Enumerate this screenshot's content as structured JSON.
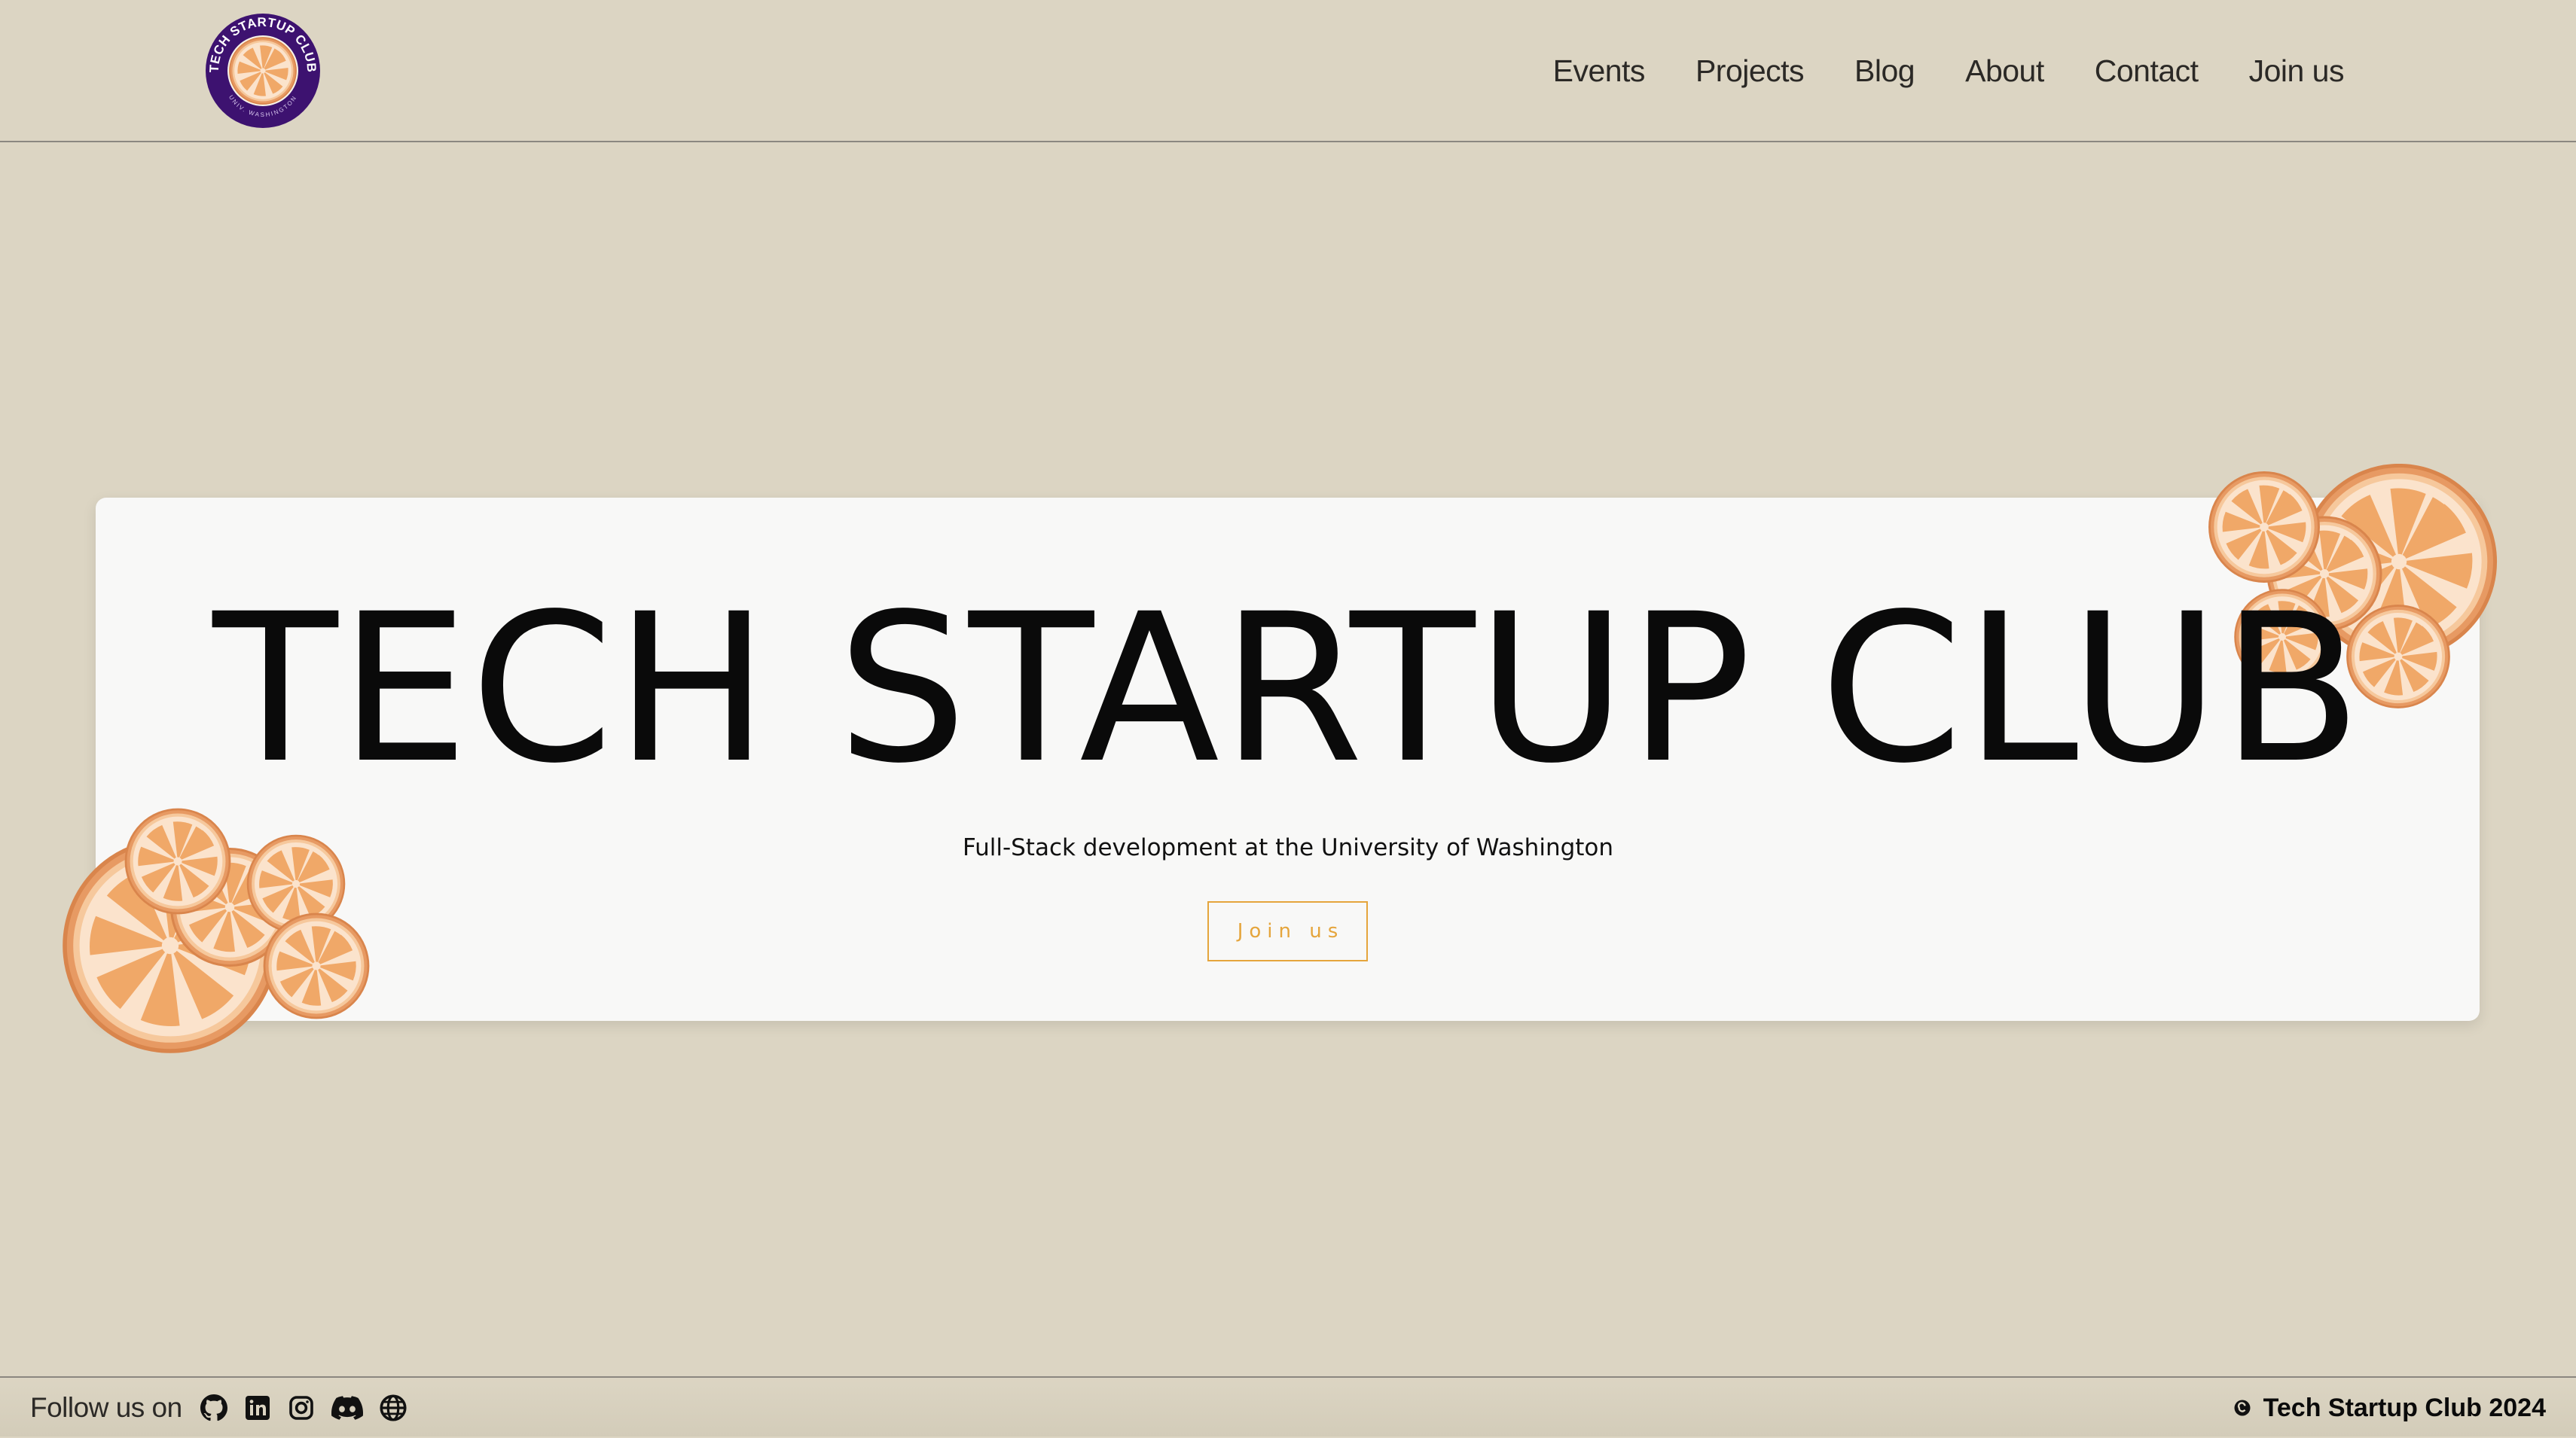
{
  "logo": {
    "arc_text": "TECH STARTUP CLUB",
    "bottom_text": "UNIV. WASHINGTON",
    "colors": {
      "ring": "#3d1270",
      "orange": "#f0a060"
    }
  },
  "nav": {
    "items": [
      {
        "label": "Events"
      },
      {
        "label": "Projects"
      },
      {
        "label": "Blog"
      },
      {
        "label": "About"
      },
      {
        "label": "Contact"
      },
      {
        "label": "Join us"
      }
    ]
  },
  "hero": {
    "title": "TECH STARTUP CLUB",
    "subtitle": "Full-Stack development at the University of Washington",
    "button_label": "Join us",
    "decoration_icon": "dried-orange-slices"
  },
  "footer": {
    "follow_label": "Follow us on",
    "socials": [
      {
        "icon": "github-icon"
      },
      {
        "icon": "linkedin-icon"
      },
      {
        "icon": "instagram-icon"
      },
      {
        "icon": "discord-icon"
      },
      {
        "icon": "globe-icon"
      }
    ],
    "copyright_icon": "copyright-icon",
    "copyright_text": "Tech Startup Club 2024"
  },
  "colors": {
    "background": "#dcd5c3",
    "card": "#f8f8f7",
    "accent": "#e5a53c",
    "text": "#0a0a0a"
  }
}
